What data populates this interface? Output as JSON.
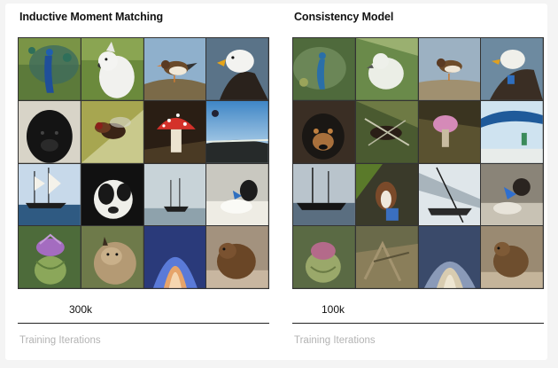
{
  "panels": [
    {
      "title": "Inductive Moment Matching",
      "iterations": "300k",
      "axis_label": "Training Iterations",
      "tiles": [
        "peacock",
        "cockatoo",
        "finch",
        "eagle",
        "puppy",
        "fly",
        "mushroom",
        "lakeside",
        "ship",
        "dog",
        "ship-sea",
        "dog-sleeping",
        "artichoke",
        "lynx",
        "flower",
        "bear"
      ]
    },
    {
      "title": "Consistency Model",
      "iterations": "100k",
      "axis_label": "Training Iterations",
      "tiles": [
        "peacock",
        "cockatoo",
        "finch",
        "eagle",
        "puppy",
        "fly",
        "mushroom",
        "lakeside",
        "ship",
        "dog",
        "ship-sea",
        "dog-sleeping",
        "artichoke",
        "lynx",
        "flower",
        "bear"
      ]
    }
  ]
}
